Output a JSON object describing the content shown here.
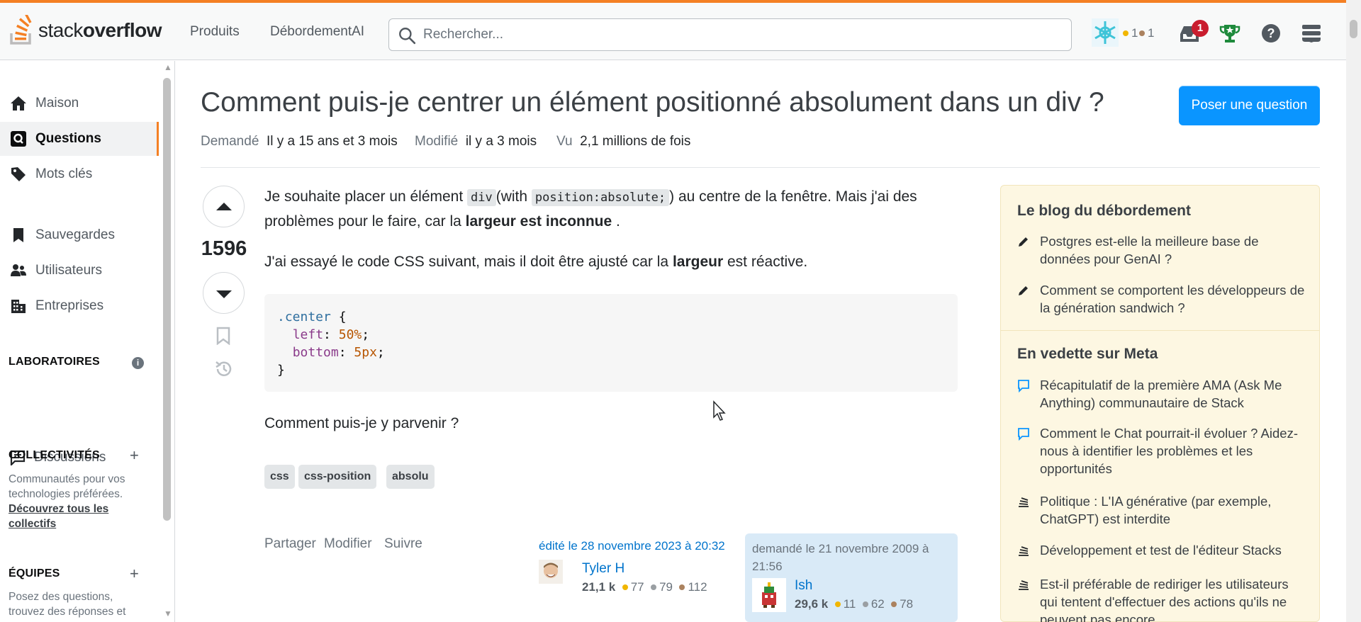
{
  "header": {
    "logo_plain": "stack",
    "logo_bold": "overflow",
    "nav": [
      "Produits",
      "DébordementAI"
    ],
    "search_placeholder": "Rechercher...",
    "gold_count": "1",
    "bronze_count": "1",
    "inbox_badge": "1"
  },
  "sidebar": {
    "items": [
      {
        "label": "Maison",
        "icon": "home-icon"
      },
      {
        "label": "Questions",
        "icon": "questions-icon",
        "active": true
      },
      {
        "label": "Mots clés",
        "icon": "tag-icon"
      },
      {
        "label": "Sauvegardes",
        "icon": "bookmark-icon"
      },
      {
        "label": "Utilisateurs",
        "icon": "users-icon"
      },
      {
        "label": "Entreprises",
        "icon": "companies-icon"
      }
    ],
    "labs_title": "LABORATOIRES",
    "discussions": "Discussions",
    "collectives_title": "COLLECTIVITÉS",
    "collectives_text": "Communautés pour vos technologies préférées.",
    "collectives_link": "Découvrez tous les collectifs",
    "teams_title": "ÉQUIPES",
    "teams_text": "Posez des questions, trouvez des réponses et"
  },
  "question": {
    "title": "Comment puis-je centrer un élément positionné absolument dans un div ?",
    "ask_button": "Poser une question",
    "asked_label": "Demandé",
    "asked_value": "Il y a 15 ans et 3 mois",
    "modified_label": "Modifié",
    "modified_value": "il y a 3 mois",
    "viewed_label": "Vu",
    "viewed_value": "2,1 millions de fois",
    "votes": "1596",
    "p1_a": "Je souhaite placer un élément ",
    "p1_code1": "div",
    "p1_b": "(with ",
    "p1_code2": "position:absolute;",
    "p1_c": ") au centre de la fenêtre. Mais j'ai des problèmes pour le faire, car la ",
    "p1_bold": "largeur est inconnue",
    "p1_d": " .",
    "p2_a": "J'ai essayé le code CSS suivant, mais il doit être ajusté car la ",
    "p2_bold": "largeur",
    "p2_b": " est réactive.",
    "code": {
      "selector": ".center",
      "open": " {",
      "prop1": "left",
      "val1": "50%",
      "prop2": "bottom",
      "val2": "5px",
      "close": "}"
    },
    "p3": "Comment puis-je y parvenir ?",
    "tags": [
      "css",
      "css-position",
      "absolu"
    ],
    "actions": [
      "Partager",
      "Modifier",
      "Suivre"
    ],
    "edited": "édité le 28 novembre 2023 à 20:32",
    "editor": {
      "name": "Tyler H",
      "rep": "21,1 k",
      "gold": "77",
      "silver": "79",
      "bronze": "112"
    },
    "asked_when": "demandé le 21 novembre 2009 à 21:56",
    "asker": {
      "name": "Ish",
      "rep": "29,6 k",
      "gold": "11",
      "silver": "62",
      "bronze": "78"
    }
  },
  "blog": {
    "title": "Le blog du débordement",
    "items": [
      "Postgres est-elle la meilleure base de données pour GenAI ?",
      "Comment se comportent les développeurs de la génération sandwich ?"
    ],
    "meta_title": "En vedette sur Meta",
    "meta_items": [
      "Récapitulatif de la première AMA (Ask Me Anything) communautaire de Stack",
      "Comment le Chat pourrait-il évoluer ? Aidez-nous à identifier les problèmes et les opportunités",
      "Politique : L'IA générative (par exemple, ChatGPT) est interdite",
      "Développement et test de l'éditeur Stacks",
      "Est-il préférable de rediriger les utilisateurs qui tentent d'effectuer des actions qu'ils ne peuvent pas encore"
    ]
  },
  "colors": {
    "accent": "#f48024",
    "primary": "#0a95ff",
    "link": "#0074cc",
    "gold": "#f1b600",
    "silver": "#9a9fa3",
    "bronze": "#ab825f"
  }
}
